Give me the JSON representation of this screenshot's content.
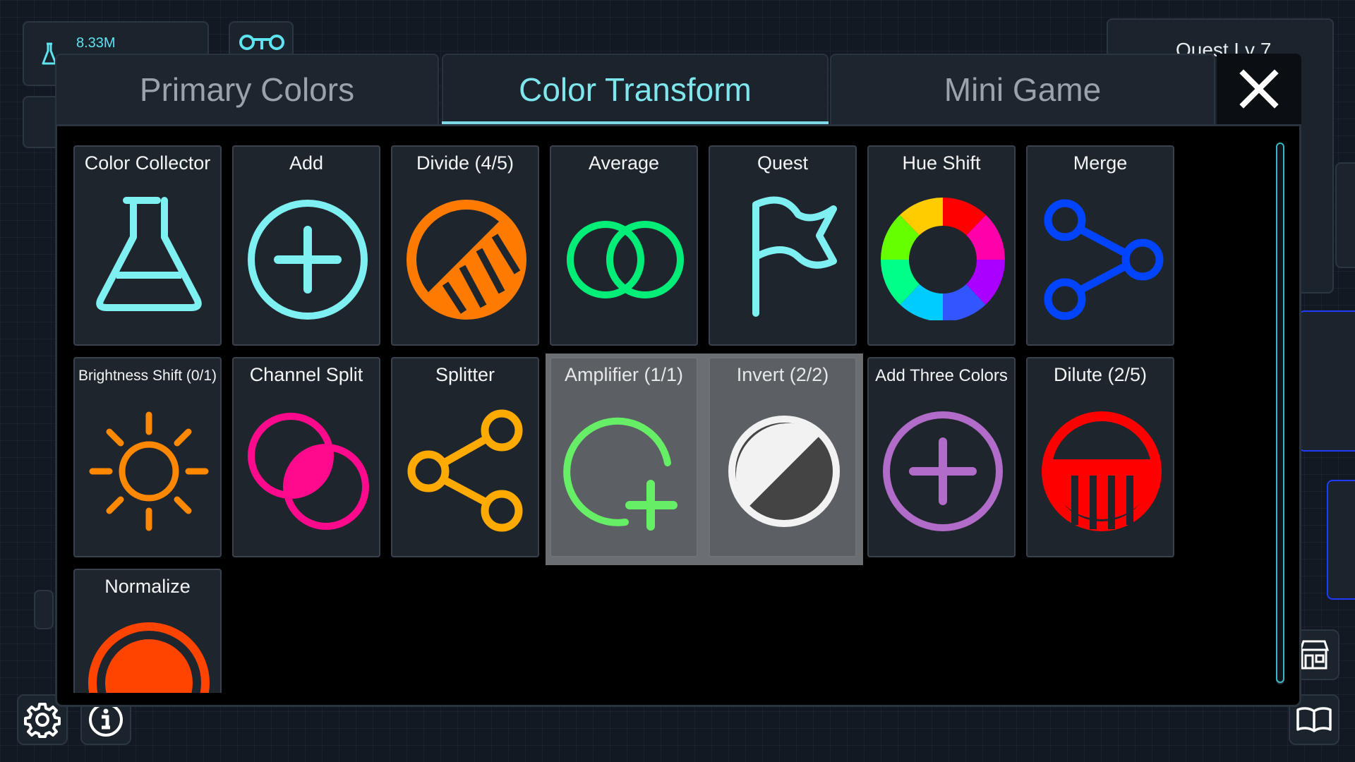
{
  "hud": {
    "money": "8.33M",
    "quest_label": "Quest Lv 7"
  },
  "tabs": [
    {
      "label": "Primary Colors",
      "active": false
    },
    {
      "label": "Color Transform",
      "active": true
    },
    {
      "label": "Mini Game",
      "active": false
    }
  ],
  "close_icon": "close-icon",
  "cards": [
    {
      "title": "Color Collector",
      "icon": "flask-icon",
      "color": "#7ff0f2"
    },
    {
      "title": "Add",
      "icon": "plus-circle-icon",
      "color": "#7ff0f2"
    },
    {
      "title": "Divide (4/5)",
      "icon": "divide-icon",
      "color": "#ff7a00"
    },
    {
      "title": "Average",
      "icon": "overlap-rings-icon",
      "color": "#00ee77"
    },
    {
      "title": "Quest",
      "icon": "flag-icon",
      "color": "#7ff0f2"
    },
    {
      "title": "Hue Shift",
      "icon": "color-wheel-icon",
      "color": "#ff00ff"
    },
    {
      "title": "Merge",
      "icon": "merge-icon",
      "color": "#0044ff"
    },
    {
      "title": "Brightness Shift (0/1)",
      "icon": "sun-icon",
      "color": "#ff8800"
    },
    {
      "title": "Channel Split",
      "icon": "channel-split-icon",
      "color": "#ff0a8c"
    },
    {
      "title": "Splitter",
      "icon": "splitter-icon",
      "color": "#ffaa00"
    },
    {
      "title": "Amplifier (1/1)",
      "icon": "amplifier-icon",
      "color": "#66ee66"
    },
    {
      "title": "Invert (2/2)",
      "icon": "invert-icon",
      "color": "#f2f2f2"
    },
    {
      "title": "Add Three Colors",
      "icon": "plus-circle-purple-icon",
      "color": "#b06cc8"
    },
    {
      "title": "Dilute (2/5)",
      "icon": "dilute-icon",
      "color": "#ff0000"
    },
    {
      "title": "Normalize",
      "icon": "normalize-icon",
      "color": "#ff4400"
    }
  ]
}
